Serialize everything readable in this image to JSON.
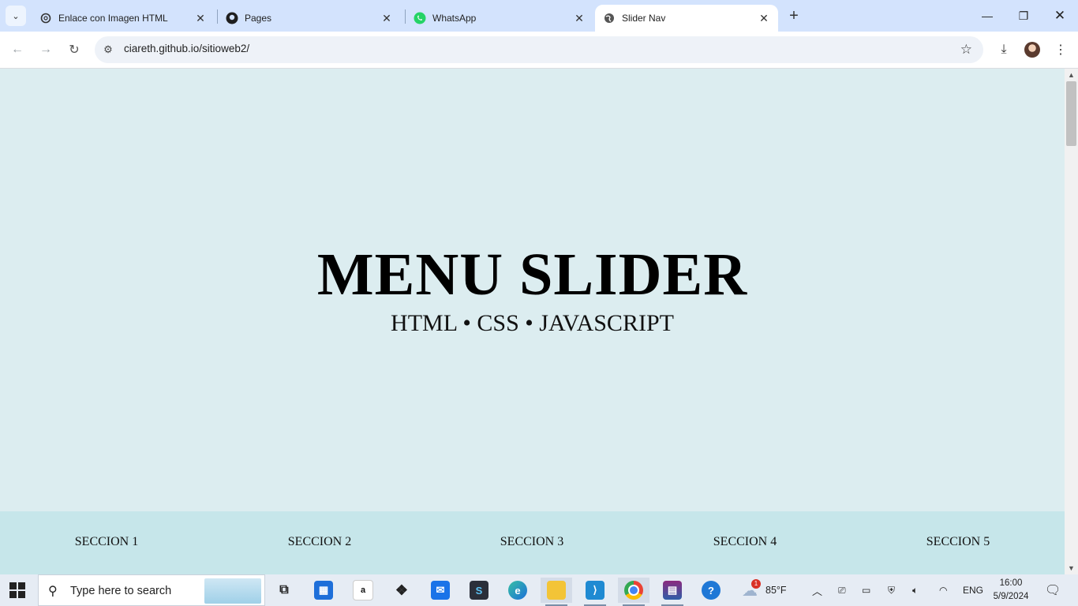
{
  "browser": {
    "tabs": [
      {
        "title": "Enlace con Imagen HTML",
        "icon": "openai-icon",
        "active": false
      },
      {
        "title": "Pages",
        "icon": "github-icon",
        "active": false
      },
      {
        "title": "WhatsApp",
        "icon": "whatsapp-icon",
        "active": false
      },
      {
        "title": "Slider Nav",
        "icon": "globe-icon",
        "active": true
      }
    ],
    "url": "ciareth.github.io/sitioweb2/"
  },
  "page": {
    "title": "MENU SLIDER",
    "subtitle": "HTML • CSS • JAVASCRIPT",
    "nav": [
      "SECCION 1",
      "SECCION 2",
      "SECCION 3",
      "SECCION 4",
      "SECCION 5"
    ],
    "colors": {
      "background": "#dcedf0",
      "nav_background": "#c6e6ea"
    }
  },
  "taskbar": {
    "search_placeholder": "Type here to search",
    "weather": {
      "temp": "85°F",
      "badge": "1"
    },
    "language": "ENG",
    "time": "16:00",
    "date": "5/9/2024"
  }
}
